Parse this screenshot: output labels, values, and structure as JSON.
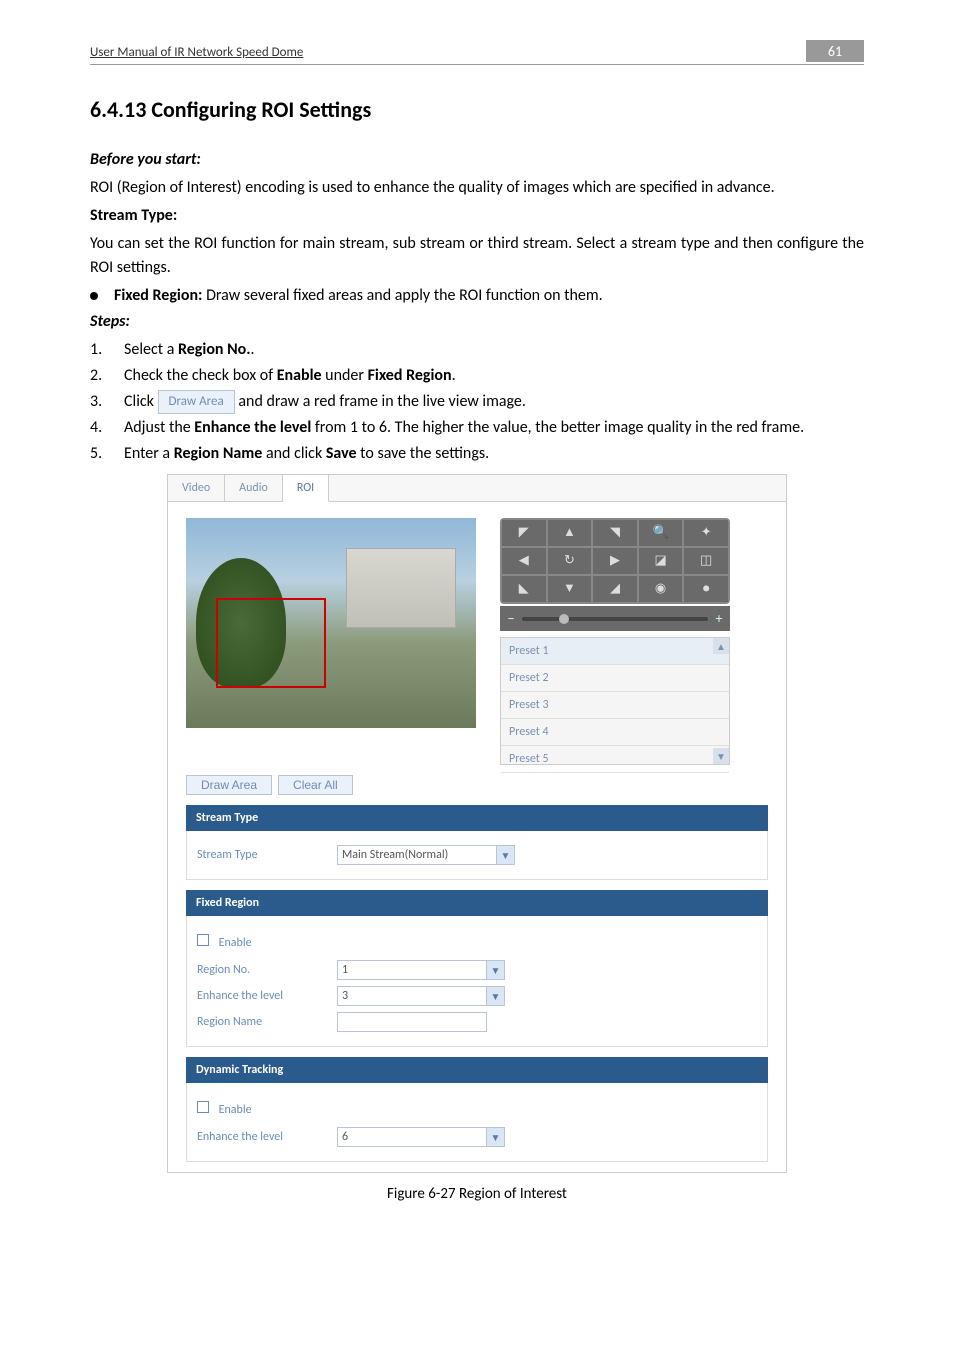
{
  "header": {
    "title": "User Manual of IR Network Speed Dome",
    "page_number": "61"
  },
  "heading": "6.4.13 Configuring ROI Settings",
  "intro": {
    "before_label": "Before you start:",
    "before_text": "ROI (Region of Interest) encoding is used to enhance the quality of images which are specified in advance.",
    "stream_label": "Stream Type:",
    "stream_text": "You can set the ROI function for main stream, sub stream or third stream. Select a stream type and then configure the ROI settings.",
    "fixed_region_bullet_bold": "Fixed Region:",
    "fixed_region_bullet_rest": " Draw several fixed areas and apply the ROI function on them.",
    "steps_label": "Steps:"
  },
  "steps": {
    "s1_num": "1.",
    "s1_pre": "Select a ",
    "s1_bold": "Region No.",
    "s1_post": ".",
    "s2_num": "2.",
    "s2_pre": "Check the check box of ",
    "s2_bold1": "Enable",
    "s2_mid": " under ",
    "s2_bold2": "Fixed Region",
    "s2_post": ".",
    "s3_num": "3.",
    "s3_pre": "Click ",
    "s3_btn": "Draw Area",
    "s3_post": " and draw a red frame in the live view image.",
    "s4_num": "4.",
    "s4_pre": "Adjust the ",
    "s4_bold": "Enhance the level",
    "s4_post": " from 1 to 6. The higher the value, the better image quality in the red frame.",
    "s5_num": "5.",
    "s5_pre": "Enter a ",
    "s5_bold1": "Region Name",
    "s5_mid": " and click ",
    "s5_bold2": "Save",
    "s5_post": " to save the settings."
  },
  "ui": {
    "tabs": {
      "video": "Video",
      "audio": "Audio",
      "roi": "ROI"
    },
    "presets": {
      "p1": "Preset 1",
      "p2": "Preset 2",
      "p3": "Preset 3",
      "p4": "Preset 4",
      "p5": "Preset 5"
    },
    "buttons": {
      "draw_area": "Draw Area",
      "clear_all": "Clear All"
    },
    "sections": {
      "stream_type": "Stream Type",
      "fixed_region": "Fixed Region",
      "dynamic_tracking": "Dynamic Tracking"
    },
    "labels": {
      "stream_type": "Stream Type",
      "enable": "Enable",
      "region_no": "Region No.",
      "enhance_level": "Enhance the level",
      "region_name": "Region Name"
    },
    "values": {
      "stream_type": "Main Stream(Normal)",
      "region_no": "1",
      "enhance_level_fixed": "3",
      "region_name": "",
      "enhance_level_dynamic": "6"
    },
    "slider": {
      "minus": "−",
      "plus": "+"
    }
  },
  "figure_caption": "Figure 6-27 Region of Interest"
}
